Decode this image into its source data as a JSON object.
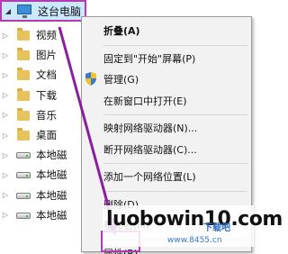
{
  "tree": {
    "root_label": "这台电脑",
    "items": [
      {
        "label": "视频",
        "icon": "video-folder-icon",
        "kind": "folder"
      },
      {
        "label": "图片",
        "icon": "pictures-folder-icon",
        "kind": "folder"
      },
      {
        "label": "文档",
        "icon": "documents-folder-icon",
        "kind": "folder"
      },
      {
        "label": "下载",
        "icon": "downloads-folder-icon",
        "kind": "folder"
      },
      {
        "label": "音乐",
        "icon": "music-folder-icon",
        "kind": "folder"
      },
      {
        "label": "桌面",
        "icon": "desktop-folder-icon",
        "kind": "folder"
      },
      {
        "label": "本地磁",
        "icon": "drive-icon",
        "kind": "drive"
      },
      {
        "label": "本地磁",
        "icon": "drive-icon",
        "kind": "drive"
      },
      {
        "label": "本地磁",
        "icon": "drive-icon",
        "kind": "drive"
      },
      {
        "label": "本地磁",
        "icon": "drive-icon",
        "kind": "drive"
      }
    ]
  },
  "context_menu": {
    "items": [
      {
        "label": "折叠(A)",
        "bold": true
      },
      {
        "separator": true
      },
      {
        "label": "固定到\"开始\"屏幕(P)"
      },
      {
        "label": "管理(G)",
        "icon": "shield-icon"
      },
      {
        "label": "在新窗口中打开(E)"
      },
      {
        "separator": true
      },
      {
        "label": "映射网络驱动器(N)..."
      },
      {
        "label": "断开网络驱动器(C)..."
      },
      {
        "separator": true
      },
      {
        "label": "添加一个网络位置(L)"
      },
      {
        "separator": true
      },
      {
        "label": "删除(D)"
      },
      {
        "label": "重命名(M)"
      },
      {
        "separator": true
      },
      {
        "label": "属性(R)"
      }
    ]
  },
  "watermark": {
    "text": "luobowin10.com",
    "sub": "www.8455.cn",
    "logo": "下载吧"
  },
  "colors": {
    "highlight": "#b23bb5",
    "selection": "#cce8ff"
  }
}
